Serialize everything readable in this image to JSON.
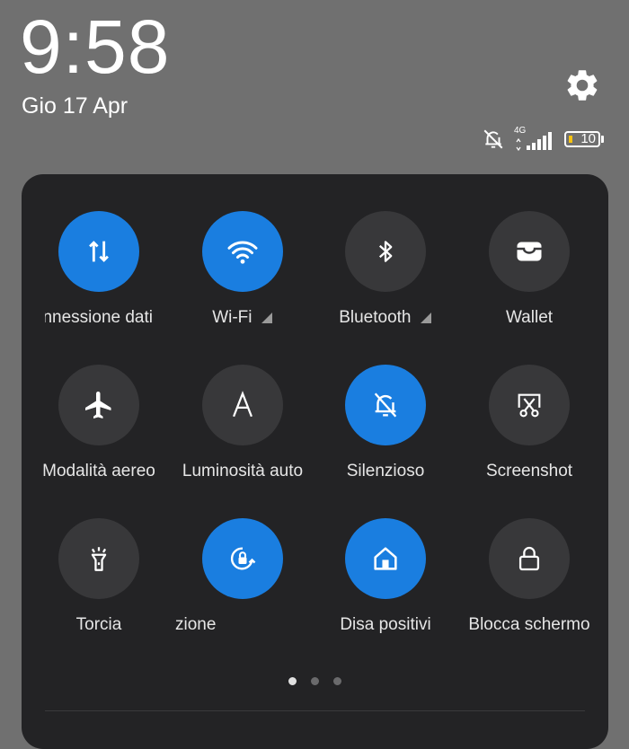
{
  "status_bar": {
    "time": "9:58",
    "date": "Gio 17 Apr",
    "network_type": "4G",
    "battery_level": "10",
    "icons": [
      "silent-icon",
      "signal-icon",
      "battery-icon",
      "gear-icon"
    ]
  },
  "colors": {
    "accent": "#1a7ee0",
    "tile_off": "#38383a",
    "panel": "#232325",
    "background": "#707070"
  },
  "quick_tiles": [
    {
      "label": "Connessione dati",
      "icon": "data-transfer-icon",
      "active": true
    },
    {
      "label": "Wi-Fi",
      "icon": "wifi-icon",
      "active": true
    },
    {
      "label": "Bluetooth",
      "icon": "bluetooth-icon",
      "active": false
    },
    {
      "label": "Wallet",
      "icon": "wallet-icon",
      "active": false
    },
    {
      "label": "Modalità aereo",
      "icon": "airplane-icon",
      "active": false
    },
    {
      "label": "Luminosità auto",
      "icon": "auto-brightness-icon",
      "active": false
    },
    {
      "label": "Silenzioso",
      "icon": "silent-icon",
      "active": true
    },
    {
      "label": "Screenshot",
      "icon": "screenshot-icon",
      "active": false
    },
    {
      "label": "Torcia",
      "icon": "flashlight-icon",
      "active": false
    },
    {
      "label": "zione",
      "icon": "rotation-lock-icon",
      "active": true
    },
    {
      "label": "Disa positivi",
      "icon": "home-icon",
      "active": true
    },
    {
      "label": "Blocca schermo",
      "icon": "lock-icon",
      "active": false
    }
  ],
  "pager": {
    "pages": 3,
    "current": 1
  }
}
